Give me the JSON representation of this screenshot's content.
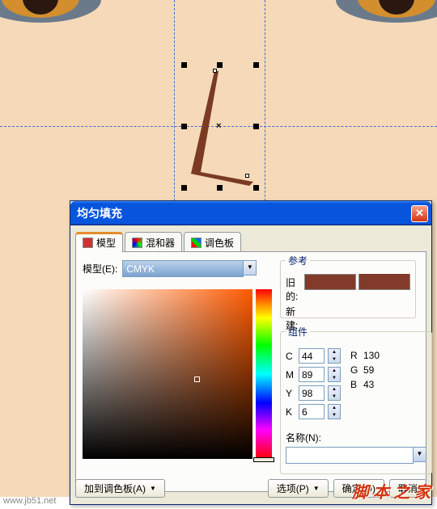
{
  "dialog": {
    "title": "均匀填充",
    "tabs": {
      "model": "模型",
      "mixer": "混和器",
      "palette": "调色板"
    },
    "model_label": "模型(E):",
    "model_value": "CMYK",
    "reference": {
      "legend": "参考",
      "old_label": "旧的:",
      "new_label": "新建:",
      "color": "#823b2b"
    },
    "components": {
      "legend": "组件",
      "c": {
        "label": "C",
        "value": "44"
      },
      "m": {
        "label": "M",
        "value": "89"
      },
      "y": {
        "label": "Y",
        "value": "98"
      },
      "k": {
        "label": "K",
        "value": "6"
      },
      "r": {
        "label": "R",
        "value": "130"
      },
      "g": {
        "label": "G",
        "value": "59"
      },
      "b": {
        "label": "B",
        "value": "43"
      },
      "name_label": "名称(N):"
    },
    "buttons": {
      "add_palette": "加到调色板(A)",
      "options": "选项(P)",
      "ok": "确定(O)",
      "cancel": "取消"
    }
  },
  "watermark": {
    "main": "脚 本 之 家",
    "url": "www.jb51.net"
  },
  "chart_data": {
    "type": "color-picker",
    "colorspace": "CMYK",
    "cmyk": [
      44,
      89,
      98,
      6
    ],
    "rgb": [
      130,
      59,
      43
    ],
    "hex": "#823b2b"
  }
}
